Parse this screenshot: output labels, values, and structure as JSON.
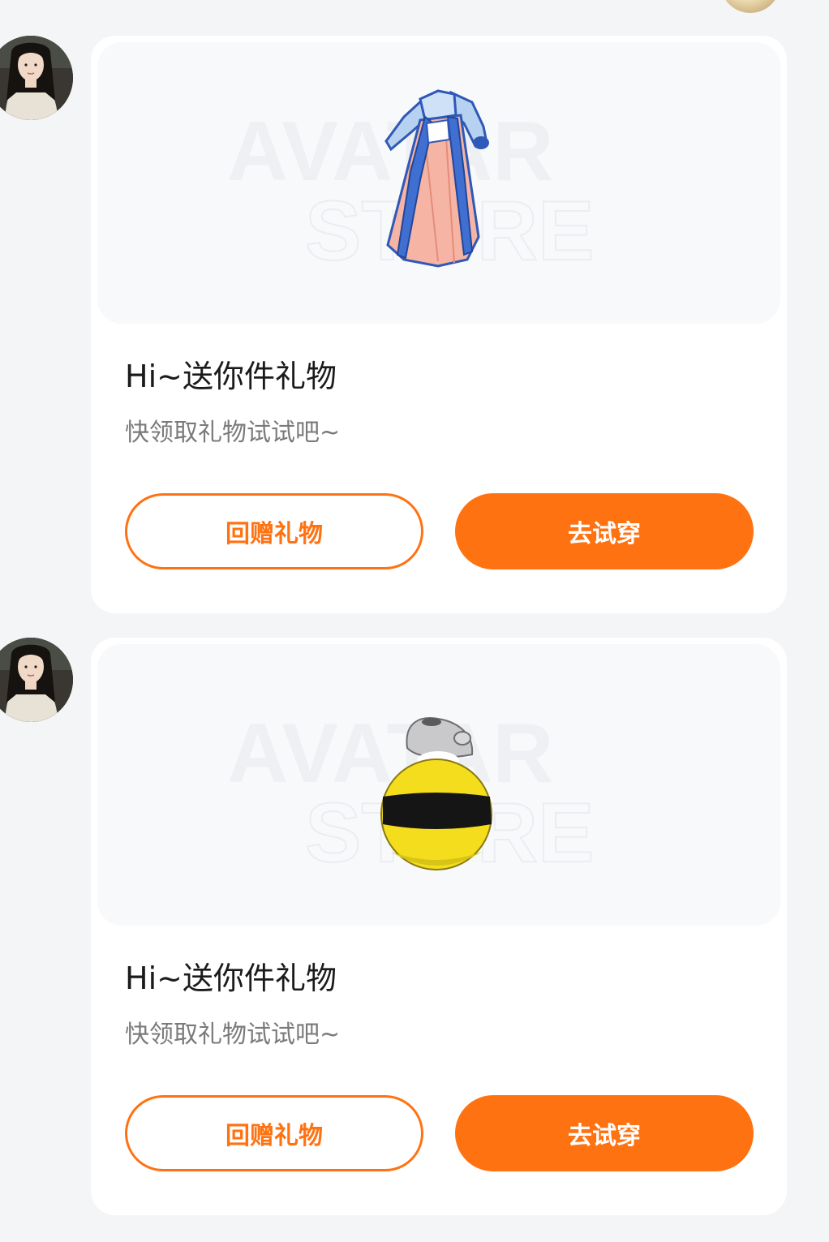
{
  "watermark": {
    "line1": "AVATAR",
    "line2": "STORE"
  },
  "messages": [
    {
      "item_icon": "hanfu-dress-icon",
      "title": "Hi~送你件礼物",
      "subtitle": "快领取礼物试试吧~",
      "return_gift_label": "回赠礼物",
      "try_on_label": "去试穿"
    },
    {
      "item_icon": "bee-costume-icon",
      "title": "Hi~送你件礼物",
      "subtitle": "快领取礼物试试吧~",
      "return_gift_label": "回赠礼物",
      "try_on_label": "去试穿"
    }
  ],
  "colors": {
    "accent": "#ff7212",
    "background": "#f4f5f7",
    "card": "#ffffff",
    "preview_bg": "#f8f9fb"
  }
}
